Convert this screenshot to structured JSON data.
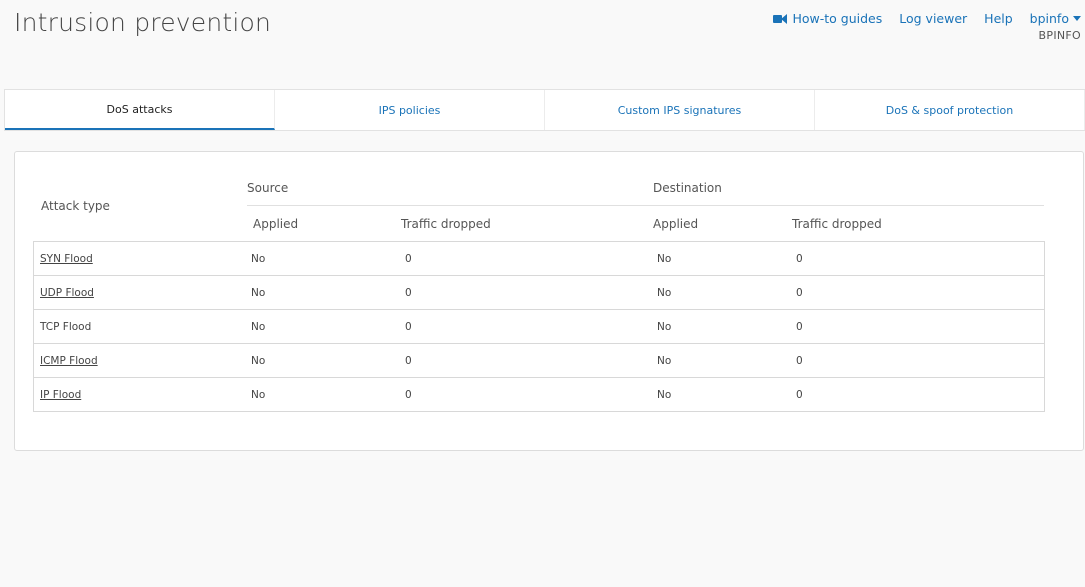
{
  "header": {
    "title": "Intrusion prevention",
    "links": {
      "howto": "How-to guides",
      "log_viewer": "Log viewer",
      "help": "Help",
      "user": "bpinfo"
    },
    "user_sub": "BPINFO",
    "icons": {
      "howto": "video-camera-icon",
      "user_menu": "caret-down-icon"
    },
    "accent": "#1a73b8"
  },
  "tabs": [
    {
      "label": "DoS attacks",
      "active": true
    },
    {
      "label": "IPS policies",
      "active": false
    },
    {
      "label": "Custom IPS signatures",
      "active": false
    },
    {
      "label": "DoS & spoof protection",
      "active": false
    }
  ],
  "table": {
    "headers": {
      "attack_type": "Attack type",
      "source": "Source",
      "destination": "Destination",
      "applied": "Applied",
      "traffic_dropped": "Traffic dropped"
    },
    "rows": [
      {
        "type": "SYN Flood",
        "link": true,
        "src_applied": "No",
        "src_dropped": "0",
        "dst_applied": "No",
        "dst_dropped": "0"
      },
      {
        "type": "UDP Flood",
        "link": true,
        "src_applied": "No",
        "src_dropped": "0",
        "dst_applied": "No",
        "dst_dropped": "0"
      },
      {
        "type": "TCP Flood",
        "link": false,
        "src_applied": "No",
        "src_dropped": "0",
        "dst_applied": "No",
        "dst_dropped": "0"
      },
      {
        "type": "ICMP Flood",
        "link": true,
        "src_applied": "No",
        "src_dropped": "0",
        "dst_applied": "No",
        "dst_dropped": "0"
      },
      {
        "type": "IP Flood",
        "link": true,
        "src_applied": "No",
        "src_dropped": "0",
        "dst_applied": "No",
        "dst_dropped": "0"
      }
    ]
  }
}
